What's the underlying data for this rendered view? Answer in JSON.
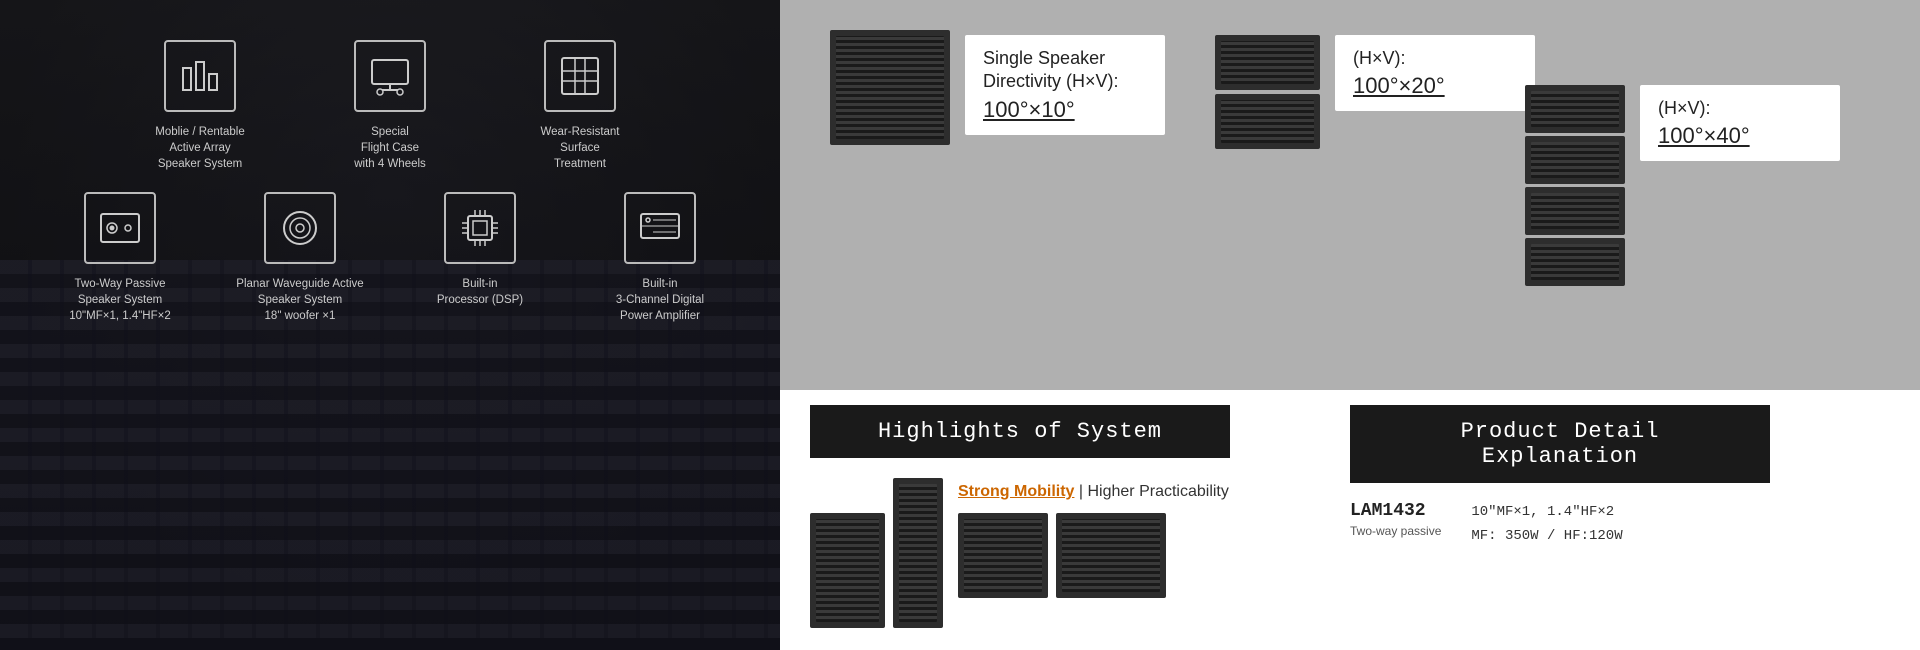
{
  "leftPanel": {
    "row1": [
      {
        "id": "mobile-array",
        "iconType": "bar-chart",
        "label": "Moblie / Rentable\nActive Array\nSpeaker System"
      },
      {
        "id": "flight-case",
        "iconType": "monitor",
        "label": "Special\nFlight Case\nwith 4 Wheels"
      },
      {
        "id": "wear-resistant",
        "iconType": "square-grid",
        "label": "Wear-Resistant\nSurface\nTreatment"
      }
    ],
    "row2": [
      {
        "id": "two-way-passive",
        "iconType": "speaker-dots",
        "label": "Two-Way Passive\nSpeaker System\n10\"MF×1, 1.4\"HF×2"
      },
      {
        "id": "planar-waveguide",
        "iconType": "circle-ring",
        "label": "Planar Waveguide Active\nSpeaker System\n18\" woofer ×1"
      },
      {
        "id": "built-in-processor",
        "iconType": "cpu",
        "label": "Built-in\nProcessor (DSP)"
      },
      {
        "id": "built-in-amplifier",
        "iconType": "monitor-line",
        "label": "Built-in\n3-Channel Digital\nPower Amplifier"
      }
    ]
  },
  "rightTopSection": {
    "singleSpeaker": {
      "title": "Single Speaker\nDirectivity (H×V):",
      "angle": "100°×10°"
    },
    "pairSpeaker": {
      "label": "(H×V):",
      "angle": "100°×20°"
    },
    "stackSpeaker": {
      "label": "(H×V):",
      "angle": "100°×40°"
    }
  },
  "bottomLeft": {
    "banner": "Highlights of System",
    "subheading": {
      "accent": "Strong Mobility",
      "rest": " | Higher Practicability"
    }
  },
  "bottomRight": {
    "banner": "Product Detail Explanation",
    "model": "LAM1432",
    "specLine1": "10\"MF×1, 1.4\"HF×2",
    "specLine2": "MF: 350W / HF:120W",
    "specLine3": "Two-way passive"
  }
}
